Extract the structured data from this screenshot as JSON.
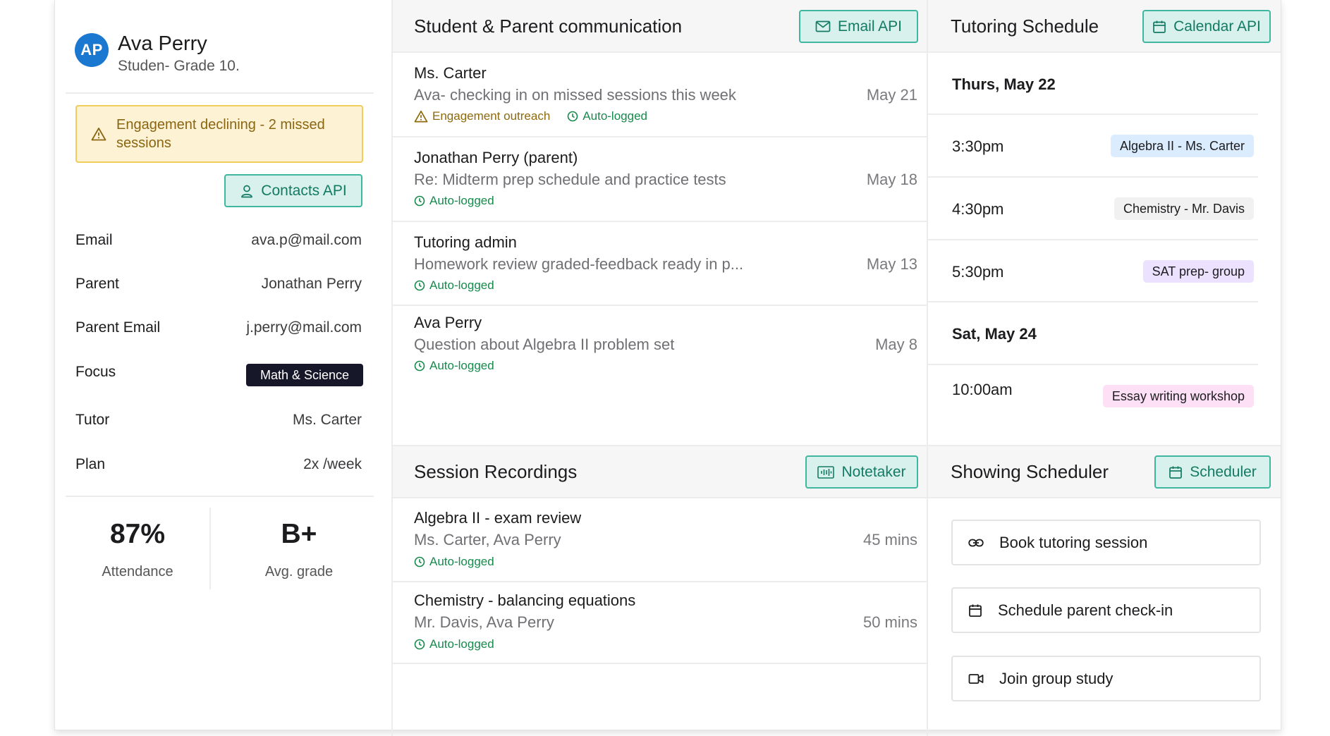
{
  "profile": {
    "initials": "AP",
    "name": "Ava Perry",
    "subtitle": "Studen- Grade 10.",
    "alert": "Engagement declining - 2 missed sessions",
    "contacts_button": "Contacts API",
    "fields": [
      {
        "label": "Email",
        "value": "ava.p@mail.com"
      },
      {
        "label": "Parent",
        "value": "Jonathan Perry"
      },
      {
        "label": "Parent Email",
        "value": "j.perry@mail.com"
      },
      {
        "label": "Focus",
        "value": "Math & Science"
      },
      {
        "label": "Tutor",
        "value": "Ms. Carter"
      },
      {
        "label": "Plan",
        "value": "2x /week"
      }
    ],
    "stats": [
      {
        "value": "87%",
        "label": "Attendance"
      },
      {
        "value": "B+",
        "label": "Avg. grade"
      }
    ]
  },
  "communication": {
    "title": "Student & Parent communication",
    "button": "Email API",
    "messages": [
      {
        "from": "Ms. Carter",
        "subject": "Ava- checking in on missed sessions this week",
        "date": "May 21",
        "tags": [
          "Engagement outreach",
          "Auto-logged"
        ]
      },
      {
        "from": "Jonathan Perry (parent)",
        "subject": "Re: Midterm prep schedule and practice tests",
        "date": "May 18",
        "tags": [
          "Auto-logged"
        ]
      },
      {
        "from": "Tutoring admin",
        "subject": "Homework review graded-feedback ready in p...",
        "date": "May 13",
        "tags": [
          "Auto-logged"
        ]
      },
      {
        "from": "Ava Perry",
        "subject": "Question about Algebra II problem set",
        "date": "May 8",
        "tags": [
          "Auto-logged"
        ]
      }
    ]
  },
  "recordings": {
    "title": "Session Recordings",
    "button": "Notetaker",
    "items": [
      {
        "title": "Algebra II - exam review",
        "people": "Ms. Carter, Ava Perry",
        "duration": "45 mins",
        "tag": "Auto-logged"
      },
      {
        "title": "Chemistry - balancing equations",
        "people": "Mr. Davis, Ava Perry",
        "duration": "50 mins",
        "tag": "Auto-logged"
      }
    ]
  },
  "schedule": {
    "title": "Tutoring Schedule",
    "button": "Calendar API",
    "day1": "Thurs, May 22",
    "day2": "Sat, May 24",
    "slots": [
      {
        "time": "3:30pm",
        "event": "Algebra II - Ms. Carter"
      },
      {
        "time": "4:30pm",
        "event": "Chemistry - Mr. Davis"
      },
      {
        "time": "5:30pm",
        "event": "SAT prep- group"
      },
      {
        "time": "10:00am",
        "event": "Essay writing workshop"
      }
    ]
  },
  "scheduler": {
    "title": "Showing Scheduler",
    "button": "Scheduler",
    "actions": [
      {
        "label": "Book tutoring session",
        "icon": "link-icon"
      },
      {
        "label": "Schedule parent check-in",
        "icon": "calendar-icon"
      },
      {
        "label": "Join group study",
        "icon": "video-icon"
      }
    ]
  },
  "colors": {
    "accent_teal": "#3fb79e",
    "alert_amber": "#f0cc5a",
    "avatar_blue": "#1b78d0",
    "auto_logged_green": "#168a4c"
  }
}
